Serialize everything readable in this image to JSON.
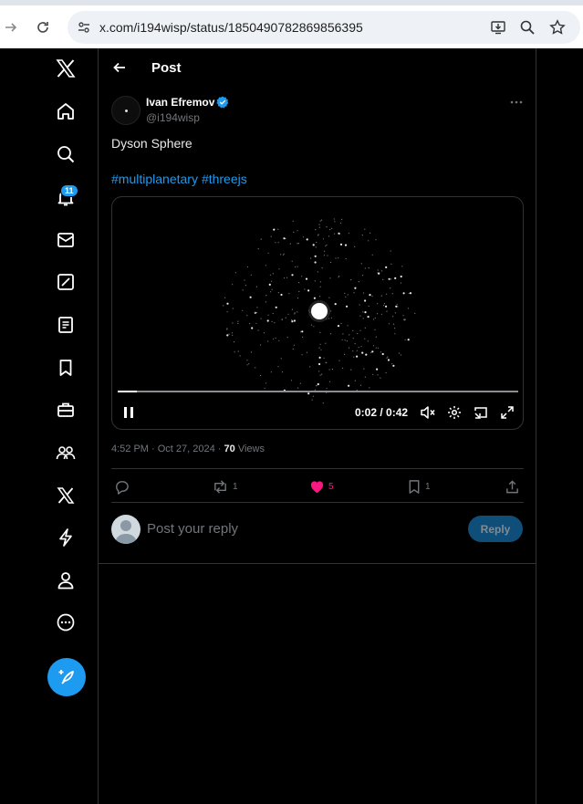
{
  "browser": {
    "url": "x.com/i194wisp/status/1850490782869856395"
  },
  "sidebar": {
    "notification_count": "11",
    "items": [
      {
        "name": "x-logo-icon"
      },
      {
        "name": "home-icon"
      },
      {
        "name": "search-icon"
      },
      {
        "name": "notifications-icon"
      },
      {
        "name": "messages-icon"
      },
      {
        "name": "grok-icon"
      },
      {
        "name": "lists-icon"
      },
      {
        "name": "bookmarks-icon"
      },
      {
        "name": "jobs-icon"
      },
      {
        "name": "communities-icon"
      },
      {
        "name": "premium-icon"
      },
      {
        "name": "verified-orgs-icon"
      },
      {
        "name": "profile-icon"
      },
      {
        "name": "more-icon"
      }
    ]
  },
  "header": {
    "title": "Post"
  },
  "post": {
    "author_name": "Ivan Efremov",
    "handle": "@i194wisp",
    "text": "Dyson Sphere",
    "hashtags": [
      "#multiplanetary",
      "#threejs"
    ],
    "video": {
      "time": "0:02 / 0:42",
      "progress": 0.048
    },
    "timestamp": "4:52 PM · Oct 27, 2024 · ",
    "views_count": "70",
    "views_label": " Views",
    "actions": {
      "replies": "",
      "reposts": "1",
      "likes": "5",
      "bookmarks": "1"
    }
  },
  "reply": {
    "placeholder": "Post your reply",
    "button_label": "Reply"
  },
  "colors": {
    "accent": "#1d9bf0",
    "like": "#f91880",
    "muted": "#71767b"
  }
}
